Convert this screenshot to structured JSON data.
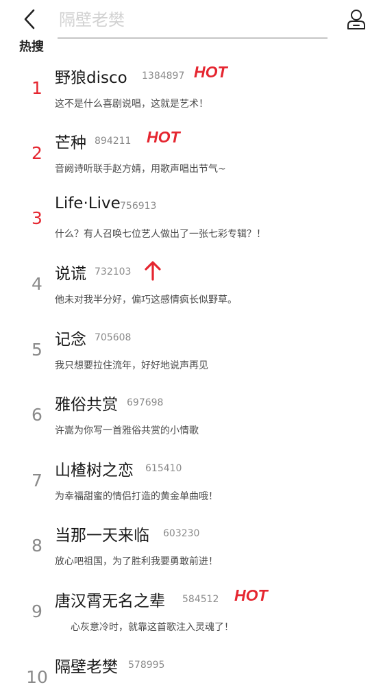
{
  "header": {
    "search_placeholder": "隔壁老樊",
    "section_title": "热搜"
  },
  "colors": {
    "accent_red": "#e52630",
    "rank_gray": "#8a8a8a"
  },
  "hot_search": [
    {
      "rank": "1",
      "title": "野狼disco",
      "count": "1384897",
      "badge": "HOT",
      "desc": "这不是什么喜剧说唱，这就是艺术！"
    },
    {
      "rank": "2",
      "title": "芒种",
      "count": "894211",
      "badge": "HOT",
      "desc": "音阙诗听联手赵方婧，用歌声唱出节气~"
    },
    {
      "rank": "3",
      "title": "Life·Live",
      "count": "756913",
      "badge": "",
      "desc": "什么？有人召唤七位艺人做出了一张七彩专辑？！"
    },
    {
      "rank": "4",
      "title": "说谎",
      "count": "732103",
      "badge": "up-arrow",
      "desc": "他未对我半分好，偏巧这感情疯长似野草。"
    },
    {
      "rank": "5",
      "title": "记念",
      "count": "705608",
      "badge": "",
      "desc": "我只想要拉住流年，好好地说声再见"
    },
    {
      "rank": "6",
      "title": "雅俗共赏",
      "count": "697698",
      "badge": "",
      "desc": "许嵩为你写一首雅俗共赏的小情歌"
    },
    {
      "rank": "7",
      "title": "山楂树之恋",
      "count": "615410",
      "badge": "",
      "desc": "为幸福甜蜜的情侣打造的黄金单曲哦！"
    },
    {
      "rank": "8",
      "title": "当那一天来临",
      "count": "603230",
      "badge": "",
      "desc": "放心吧祖国，为了胜利我要勇敢前进！"
    },
    {
      "rank": "9",
      "title": "唐汉霄无名之辈",
      "count": "584512",
      "badge": "HOT",
      "desc": "心灰意冷时，就靠这首歌注入灵魂了！"
    },
    {
      "rank": "10",
      "title": "隔壁老樊",
      "count": "578995",
      "badge": "",
      "desc": ""
    }
  ]
}
